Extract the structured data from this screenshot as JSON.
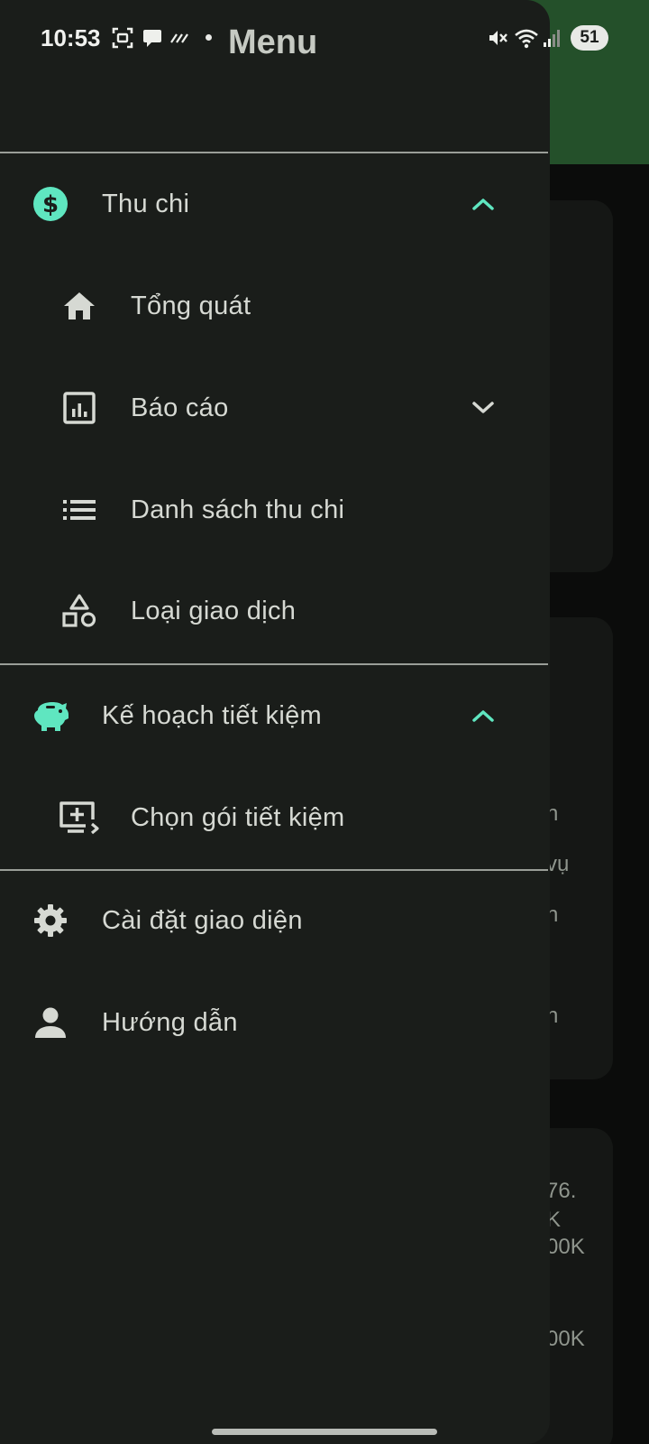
{
  "status_bar": {
    "time": "10:53",
    "battery": "51",
    "icons": [
      "screenshot-icon",
      "chat-bubble-icon",
      "haze-icon",
      "mute-icon",
      "wifi-icon",
      "signal-icon"
    ]
  },
  "drawer": {
    "title": "Menu",
    "sections": [
      {
        "label": "Thu chi",
        "icon": "dollar-circle-icon",
        "expanded": true,
        "items": [
          {
            "label": "Tổng quát",
            "icon": "home-icon"
          },
          {
            "label": "Báo cáo",
            "icon": "report-chart-icon",
            "expandable": true
          },
          {
            "label": "Danh sách thu chi",
            "icon": "list-icon"
          },
          {
            "label": "Loại giao dịch",
            "icon": "shapes-icon"
          }
        ]
      },
      {
        "label": "Kế hoạch tiết kiệm",
        "icon": "piggy-bank-icon",
        "expanded": true,
        "items": [
          {
            "label": "Chọn gói tiết kiệm",
            "icon": "add-to-screen-icon"
          }
        ]
      }
    ],
    "bottom_items": [
      {
        "label": "Cài đặt giao diện",
        "icon": "gear-icon"
      },
      {
        "label": "Hướng dẫn",
        "icon": "person-icon"
      }
    ]
  },
  "background_fragments": [
    "n",
    "vụ",
    "n",
    "n",
    "76.",
    "K",
    "00K",
    "00K"
  ],
  "colors": {
    "accent": "#5fe6c0",
    "drawer_bg": "#1a1d1a",
    "header_green": "#24502a",
    "divider": "#9a9e98"
  }
}
